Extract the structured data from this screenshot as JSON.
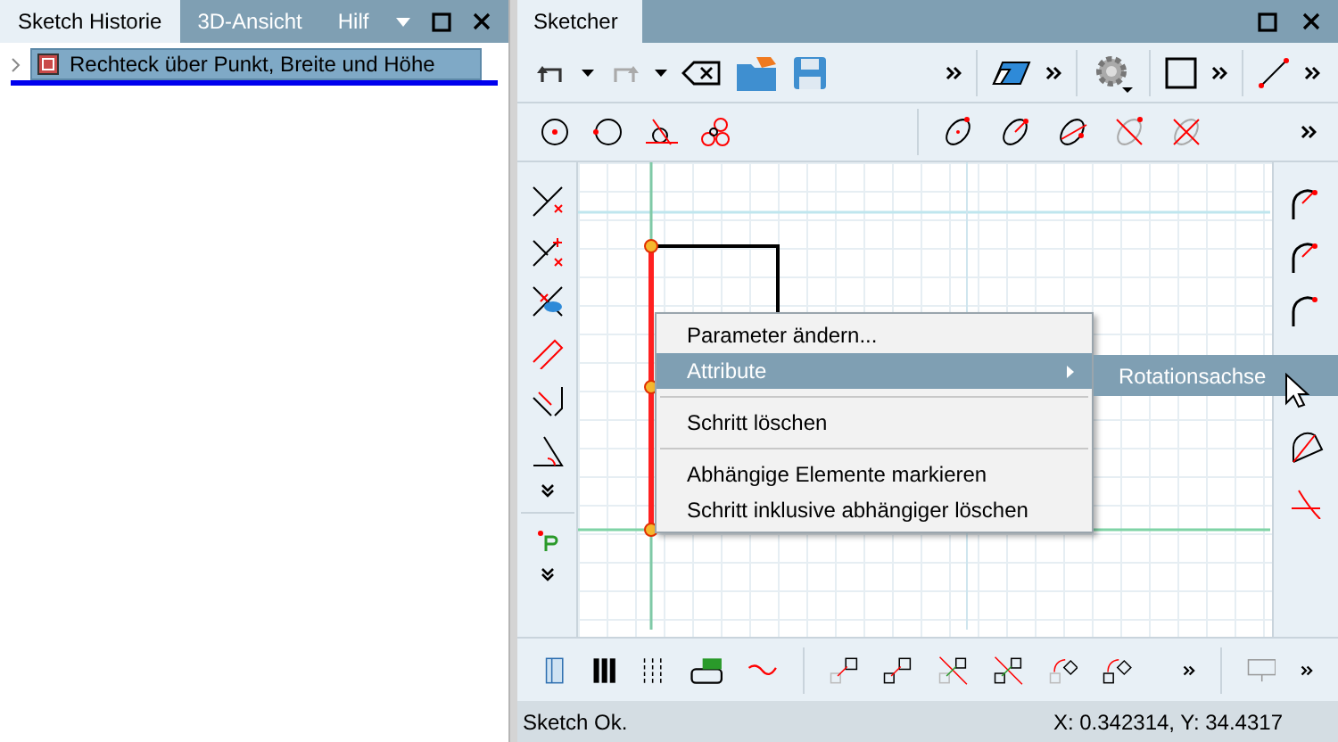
{
  "history_panel": {
    "tabs": [
      {
        "label": "Sketch Historie",
        "selected": true
      },
      {
        "label": "3D-Ansicht",
        "selected": false
      },
      {
        "label": "Hilf",
        "selected": false
      }
    ],
    "tree": [
      {
        "label": "Rechteck über Punkt, Breite und Höhe",
        "selected": true,
        "expanded": false
      }
    ]
  },
  "sketcher_panel": {
    "tab": "Sketcher"
  },
  "context_menu": {
    "items": [
      {
        "kind": "item",
        "label": "Parameter ändern...",
        "selected": false,
        "submenu": false
      },
      {
        "kind": "item",
        "label": "Attribute",
        "selected": true,
        "submenu": true
      },
      {
        "kind": "separator"
      },
      {
        "kind": "item",
        "label": "Schritt löschen",
        "selected": false,
        "submenu": false
      },
      {
        "kind": "separator"
      },
      {
        "kind": "item",
        "label": "Abhängige Elemente markieren",
        "selected": false,
        "submenu": false
      },
      {
        "kind": "item",
        "label": "Schritt inklusive abhängiger löschen",
        "selected": false,
        "submenu": false
      }
    ],
    "submenu": [
      {
        "label": "Rotationsachse",
        "selected": true
      }
    ]
  },
  "status_bar": {
    "message": "Sketch Ok.",
    "coordinates": "X: 0.342314, Y: 34.4317"
  }
}
